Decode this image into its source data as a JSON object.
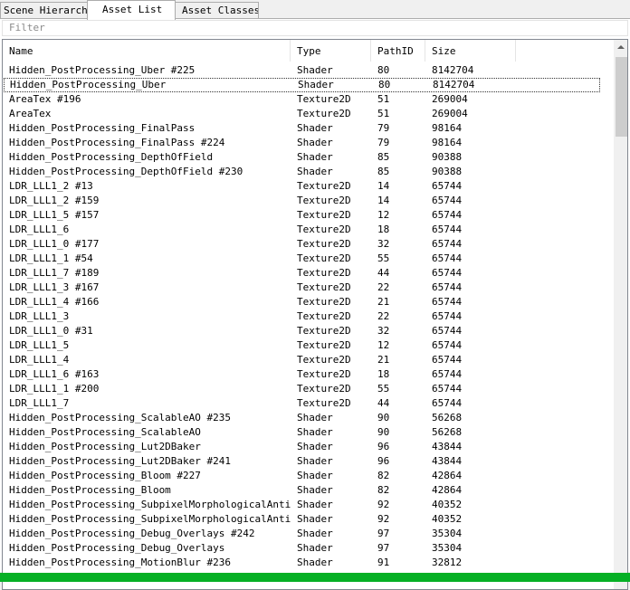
{
  "tabs": [
    {
      "label": "Scene Hierarchy"
    },
    {
      "label": "Asset List"
    },
    {
      "label": "Asset Classes"
    }
  ],
  "filter": {
    "placeholder": "Filter"
  },
  "columns": [
    "Name",
    "Type",
    "PathID",
    "Size"
  ],
  "rows": [
    [
      "Hidden_PostProcessing_Uber #225",
      "Shader",
      "80",
      "8142704"
    ],
    [
      "Hidden_PostProcessing_Uber",
      "Shader",
      "80",
      "8142704"
    ],
    [
      "AreaTex #196",
      "Texture2D",
      "51",
      "269004"
    ],
    [
      "AreaTex",
      "Texture2D",
      "51",
      "269004"
    ],
    [
      "Hidden_PostProcessing_FinalPass",
      "Shader",
      "79",
      "98164"
    ],
    [
      "Hidden_PostProcessing_FinalPass #224",
      "Shader",
      "79",
      "98164"
    ],
    [
      "Hidden_PostProcessing_DepthOfField",
      "Shader",
      "85",
      "90388"
    ],
    [
      "Hidden_PostProcessing_DepthOfField #230",
      "Shader",
      "85",
      "90388"
    ],
    [
      "LDR_LLL1_2 #13",
      "Texture2D",
      "14",
      "65744"
    ],
    [
      "LDR_LLL1_2 #159",
      "Texture2D",
      "14",
      "65744"
    ],
    [
      "LDR_LLL1_5 #157",
      "Texture2D",
      "12",
      "65744"
    ],
    [
      "LDR_LLL1_6",
      "Texture2D",
      "18",
      "65744"
    ],
    [
      "LDR_LLL1_0 #177",
      "Texture2D",
      "32",
      "65744"
    ],
    [
      "LDR_LLL1_1 #54",
      "Texture2D",
      "55",
      "65744"
    ],
    [
      "LDR_LLL1_7 #189",
      "Texture2D",
      "44",
      "65744"
    ],
    [
      "LDR_LLL1_3 #167",
      "Texture2D",
      "22",
      "65744"
    ],
    [
      "LDR_LLL1_4 #166",
      "Texture2D",
      "21",
      "65744"
    ],
    [
      "LDR_LLL1_3",
      "Texture2D",
      "22",
      "65744"
    ],
    [
      "LDR_LLL1_0 #31",
      "Texture2D",
      "32",
      "65744"
    ],
    [
      "LDR_LLL1_5",
      "Texture2D",
      "12",
      "65744"
    ],
    [
      "LDR_LLL1_4",
      "Texture2D",
      "21",
      "65744"
    ],
    [
      "LDR_LLL1_6 #163",
      "Texture2D",
      "18",
      "65744"
    ],
    [
      "LDR_LLL1_1 #200",
      "Texture2D",
      "55",
      "65744"
    ],
    [
      "LDR_LLL1_7",
      "Texture2D",
      "44",
      "65744"
    ],
    [
      "Hidden_PostProcessing_ScalableAO #235",
      "Shader",
      "90",
      "56268"
    ],
    [
      "Hidden_PostProcessing_ScalableAO",
      "Shader",
      "90",
      "56268"
    ],
    [
      "Hidden_PostProcessing_Lut2DBaker",
      "Shader",
      "96",
      "43844"
    ],
    [
      "Hidden_PostProcessing_Lut2DBaker #241",
      "Shader",
      "96",
      "43844"
    ],
    [
      "Hidden_PostProcessing_Bloom #227",
      "Shader",
      "82",
      "42864"
    ],
    [
      "Hidden_PostProcessing_Bloom",
      "Shader",
      "82",
      "42864"
    ],
    [
      "Hidden_PostProcessing_SubpixelMorphologicalAntia...",
      "Shader",
      "92",
      "40352"
    ],
    [
      "Hidden_PostProcessing_SubpixelMorphologicalAntia...",
      "Shader",
      "92",
      "40352"
    ],
    [
      "Hidden_PostProcessing_Debug_Overlays #242",
      "Shader",
      "97",
      "35304"
    ],
    [
      "Hidden_PostProcessing_Debug_Overlays",
      "Shader",
      "97",
      "35304"
    ],
    [
      "Hidden_PostProcessing_MotionBlur #236",
      "Shader",
      "91",
      "32812"
    ]
  ],
  "colors": {
    "status_bar": "#06b025",
    "selection_focus": "#333333"
  },
  "icons": [
    "scroll-up-arrow-icon"
  ]
}
